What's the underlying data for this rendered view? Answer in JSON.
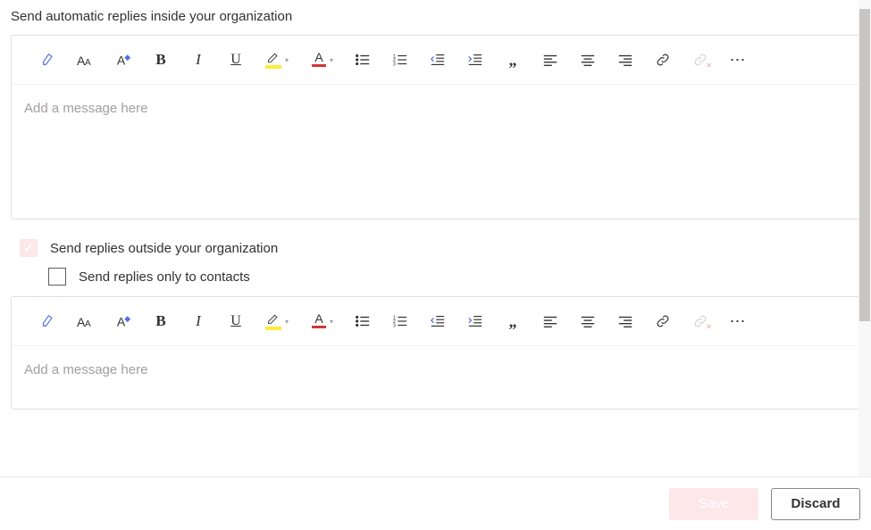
{
  "section1": {
    "title": "Send automatic replies inside your organization",
    "placeholder": "Add a message here"
  },
  "options": {
    "outside": {
      "label": "Send replies outside your organization",
      "checked": true
    },
    "contactsOnly": {
      "label": "Send replies only to contacts",
      "checked": false
    }
  },
  "section2": {
    "placeholder": "Add a message here"
  },
  "footer": {
    "save": "Save",
    "discard": "Discard"
  },
  "toolbar": {
    "paint": "Format painter",
    "font": "Font",
    "fontsize": "Font size",
    "bold": "B",
    "italic": "I",
    "underline": "U",
    "highlight": "Highlight",
    "fontcolor": "A",
    "bullets": "Bullets",
    "numbering": "Numbering",
    "outdent": "Decrease indent",
    "indent": "Increase indent",
    "quote": "Quote",
    "alignleft": "Align left",
    "aligncenter": "Align center",
    "alignright": "Align right",
    "link": "Insert link",
    "unlink": "Remove link",
    "more": "More"
  }
}
